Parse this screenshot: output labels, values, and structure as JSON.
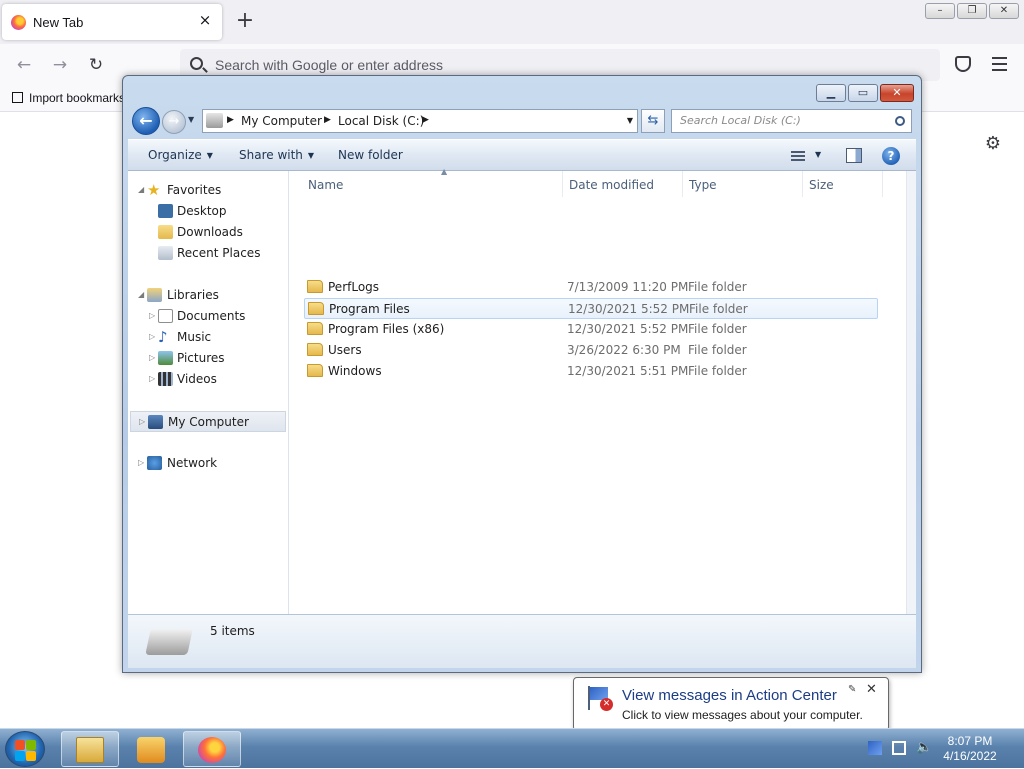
{
  "browser": {
    "tab_title": "New Tab",
    "tab_close": "×",
    "new_tab": "+",
    "url_placeholder": "Search with Google or enter address",
    "import_bookmarks": "Import bookmarks...",
    "back": "←",
    "forward": "→",
    "reload": "↻",
    "window_controls": [
      "–",
      "❐",
      "✕"
    ],
    "settings_icon": "⚙"
  },
  "explorer": {
    "window_controls": [
      "▁",
      "▭",
      "✕"
    ],
    "breadcrumbs": [
      "My Computer",
      "Local Disk (C:)"
    ],
    "search_placeholder": "Search Local Disk (C:)",
    "toolbar": {
      "organize": "Organize",
      "share_with": "Share with",
      "new_folder": "New folder",
      "help": "?"
    },
    "nav": {
      "favorites": "Favorites",
      "desktop": "Desktop",
      "downloads": "Downloads",
      "recent_places": "Recent Places",
      "libraries": "Libraries",
      "documents": "Documents",
      "music": "Music",
      "pictures": "Pictures",
      "videos": "Videos",
      "my_computer": "My Computer",
      "network": "Network"
    },
    "columns": {
      "name": "Name",
      "date_modified": "Date modified",
      "type": "Type",
      "size": "Size"
    },
    "files": [
      {
        "name": "PerfLogs",
        "date": "7/13/2009 11:20 PM",
        "type": "File folder"
      },
      {
        "name": "Program Files",
        "date": "12/30/2021 5:52 PM",
        "type": "File folder"
      },
      {
        "name": "Program Files (x86)",
        "date": "12/30/2021 5:52 PM",
        "type": "File folder"
      },
      {
        "name": "Users",
        "date": "3/26/2022 6:30 PM",
        "type": "File folder"
      },
      {
        "name": "Windows",
        "date": "12/30/2021 5:51 PM",
        "type": "File folder"
      }
    ],
    "status_count": "5 items"
  },
  "notification": {
    "title": "View messages in Action Center",
    "subtitle": "Click to view messages about your computer."
  },
  "taskbar": {
    "time": "8:07 PM",
    "date": "4/16/2022"
  }
}
